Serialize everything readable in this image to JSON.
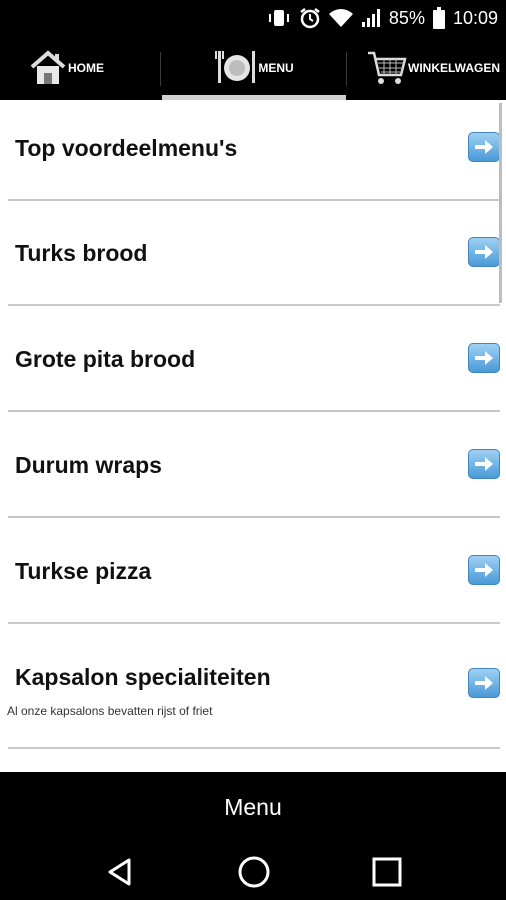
{
  "status_bar": {
    "battery": "85%",
    "time": "10:09",
    "icons": [
      "vibrate-icon",
      "alarm-icon",
      "wifi-icon",
      "signal-icon",
      "battery-icon"
    ]
  },
  "tabs": [
    {
      "label": "HOME",
      "icon": "home-icon"
    },
    {
      "label": "MENU",
      "icon": "plate-icon",
      "active": true
    },
    {
      "label": "WINKELWAGEN",
      "icon": "cart-icon"
    }
  ],
  "menu_items": [
    {
      "title": "Top voordeelmenu's"
    },
    {
      "title": "Turks brood"
    },
    {
      "title": "Grote pita brood"
    },
    {
      "title": "Durum wraps"
    },
    {
      "title": "Turkse pizza"
    },
    {
      "title": "Kapsalon specialiteiten",
      "subtitle": "Al onze kapsalons bevatten rijst of friet"
    }
  ],
  "bottom_bar": {
    "title": "Menu"
  },
  "nav_buttons": [
    "back-icon",
    "home-circle-icon",
    "recents-icon"
  ],
  "colors": {
    "bar": "#000000",
    "arrow": "#4a9ad6",
    "divider": "#c8c8c8"
  }
}
